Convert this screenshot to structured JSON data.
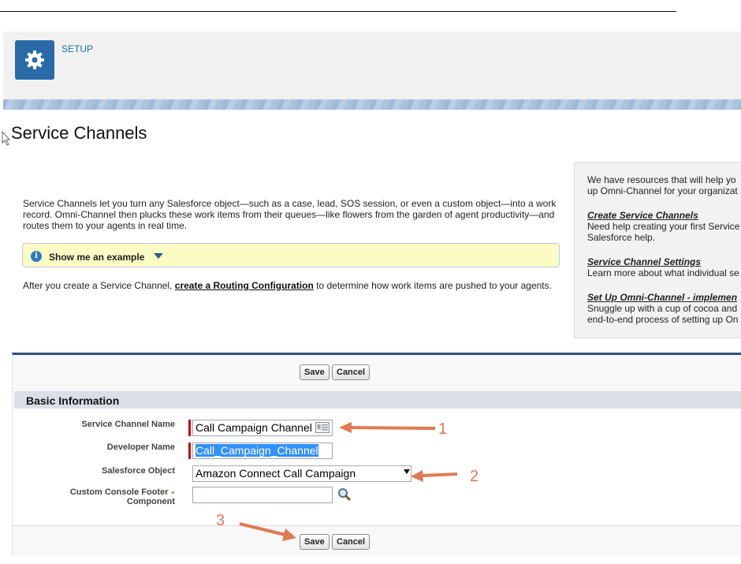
{
  "header": {
    "app_label": "SETUP",
    "icon": "gear-icon"
  },
  "page": {
    "title": "Service Channels",
    "intro": "Service Channels let you turn any Salesforce object—such as a case, lead, SOS session, or even a custom object—into a work record. Omni-Channel then plucks these work items from their queues—like flowers from the garden of agent productivity—and routes them to your agents in real time.",
    "callout_label": "Show me an example",
    "after_prefix": "After you create a Service Channel, ",
    "after_link": "create a Routing Configuration",
    "after_suffix": " to determine how work items are pushed to your agents."
  },
  "side_panel": {
    "intro_line1": "We have resources that will help yo",
    "intro_line2": "up Omni-Channel for your organizat",
    "items": [
      {
        "heading": "Create Service Channels",
        "line1": "Need help creating your first Service",
        "line2": "Salesforce help."
      },
      {
        "heading": "Service Channel Settings",
        "line1": "Learn more about what individual se",
        "line2": ""
      },
      {
        "heading": "Set Up Omni-Channel - implemen",
        "line1": "Snuggle up with a cup of cocoa and",
        "line2": "end-to-end process of setting up On"
      }
    ]
  },
  "form": {
    "save_label": "Save",
    "cancel_label": "Cancel",
    "section_title": "Basic Information",
    "fields": {
      "service_channel_name": {
        "label": "Service Channel Name",
        "value": "Call Campaign Channel"
      },
      "developer_name": {
        "label": "Developer Name",
        "value": "Call_Campaign_Channel"
      },
      "salesforce_object": {
        "label": "Salesforce Object",
        "value": "Amazon Connect Call Campaign"
      },
      "custom_console_footer": {
        "label_line1": "Custom Console Footer",
        "label_line2": "Component",
        "value": ""
      }
    }
  },
  "annotations": {
    "one": "1",
    "two": "2",
    "three": "3",
    "color": "#e07a52"
  },
  "colors": {
    "accent": "#2b6aa8",
    "section_border": "#2f4f7f",
    "required": "#cc0000",
    "callout_bg": "#fbfbc4"
  }
}
